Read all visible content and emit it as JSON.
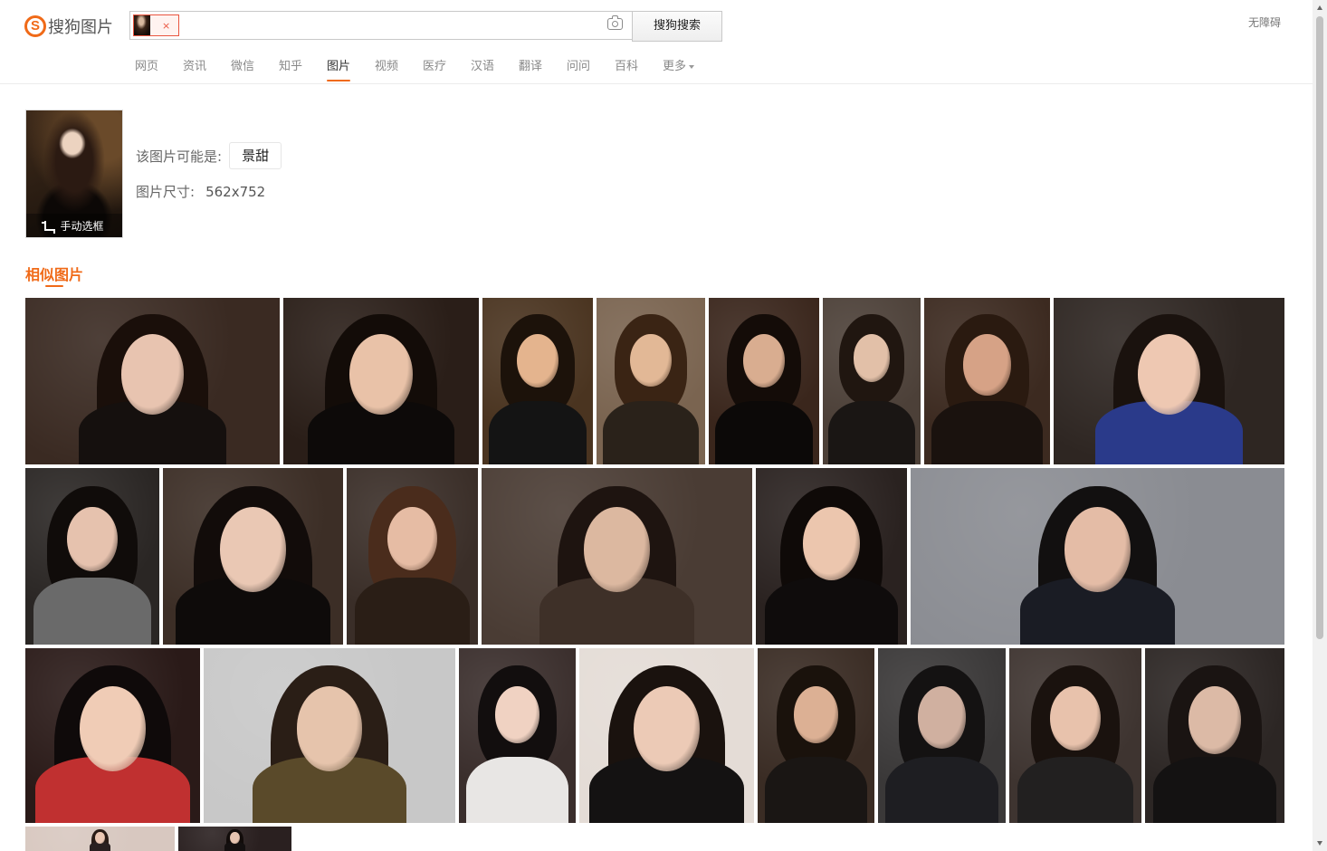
{
  "header": {
    "logo_mark": "S",
    "logo_text": "搜狗图片",
    "search_button": "搜狗搜索",
    "chip_close": "×",
    "accessibility": "无障碍"
  },
  "nav": {
    "items": [
      "网页",
      "资讯",
      "微信",
      "知乎",
      "图片",
      "视频",
      "医疗",
      "汉语",
      "翻译",
      "问问",
      "百科",
      "更多"
    ],
    "active_index": 4
  },
  "query": {
    "crop_label": "手动选框",
    "guess_label": "该图片可能是:",
    "guess_tag": "景甜",
    "size_label": "图片尺寸:",
    "size_value": "562x752"
  },
  "similar": {
    "title": "相似图片",
    "tiles": [
      {
        "tone": "#3a2a22",
        "skin": "#e8c4b0",
        "hair": "#1a0f0a",
        "cloth": "#15100e"
      },
      {
        "tone": "#2a1e18",
        "skin": "#e9c2a8",
        "hair": "#130c08",
        "cloth": "#0d0a09"
      },
      {
        "tone": "#4a3420",
        "skin": "#e4b48e",
        "hair": "#1c120a",
        "cloth": "#141414"
      },
      {
        "tone": "#7a6450",
        "skin": "#e2b896",
        "hair": "#3a2414",
        "cloth": "#2a221a"
      },
      {
        "tone": "#3a261c",
        "skin": "#d9ad90",
        "hair": "#140c08",
        "cloth": "#0c0908"
      },
      {
        "tone": "#4c4038",
        "skin": "#e2c0a8",
        "hair": "#201610",
        "cloth": "#1a1614"
      },
      {
        "tone": "#3c2a20",
        "skin": "#d6a286",
        "hair": "#2a1a10",
        "cloth": "#1a120e"
      },
      {
        "tone": "#2e2622",
        "skin": "#eec8b2",
        "hair": "#1a120e",
        "cloth": "#2a3a8a"
      },
      {
        "tone": "#2a2624",
        "skin": "#e6c2ae",
        "hair": "#100c0a",
        "cloth": "#6a6a6a"
      },
      {
        "tone": "#3c2e26",
        "skin": "#eac8b4",
        "hair": "#120c0a",
        "cloth": "#0e0b0a"
      },
      {
        "tone": "#3a2e28",
        "skin": "#e6bca4",
        "hair": "#4a2c1c",
        "cloth": "#2a1e16"
      },
      {
        "tone": "#4a3c34",
        "skin": "#dcb8a0",
        "hair": "#1e1410",
        "cloth": "#3e3028"
      },
      {
        "tone": "#2a2220",
        "skin": "#ecc6ae",
        "hair": "#0f0a08",
        "cloth": "#0f0c0c"
      },
      {
        "tone": "#8a8c92",
        "skin": "#e4bca6",
        "hair": "#121010",
        "cloth": "#1a1c24"
      },
      {
        "tone": "#2a1a18",
        "skin": "#f0ccb6",
        "hair": "#0f0a0a",
        "cloth": "#c03030"
      },
      {
        "tone": "#c8c8c8",
        "skin": "#e6c4ac",
        "hair": "#2a1e16",
        "cloth": "#5a4a2a"
      },
      {
        "tone": "#3a2e2c",
        "skin": "#f0d2c2",
        "hair": "#120e0e",
        "cloth": "#e8e6e4"
      },
      {
        "tone": "#e4dcd6",
        "skin": "#eccab6",
        "hair": "#1a120e",
        "cloth": "#141212"
      },
      {
        "tone": "#3a2c24",
        "skin": "#dcb094",
        "hair": "#1a120c",
        "cloth": "#1a1614"
      },
      {
        "tone": "#3a3838",
        "skin": "#d0b0a0",
        "hair": "#141212",
        "cloth": "#1e1e22"
      },
      {
        "tone": "#3e3430",
        "skin": "#e8c2ac",
        "hair": "#1a120e",
        "cloth": "#222020"
      },
      {
        "tone": "#2c2624",
        "skin": "#dcbaa6",
        "hair": "#1a1412",
        "cloth": "#141212"
      },
      {
        "tone": "#d8c8c0",
        "skin": "#ecc8b4",
        "hair": "#2a1c16",
        "cloth": "#2a2020"
      },
      {
        "tone": "#2a2020",
        "skin": "#e6c4b0",
        "hair": "#120c0a",
        "cloth": "#141010"
      }
    ]
  }
}
